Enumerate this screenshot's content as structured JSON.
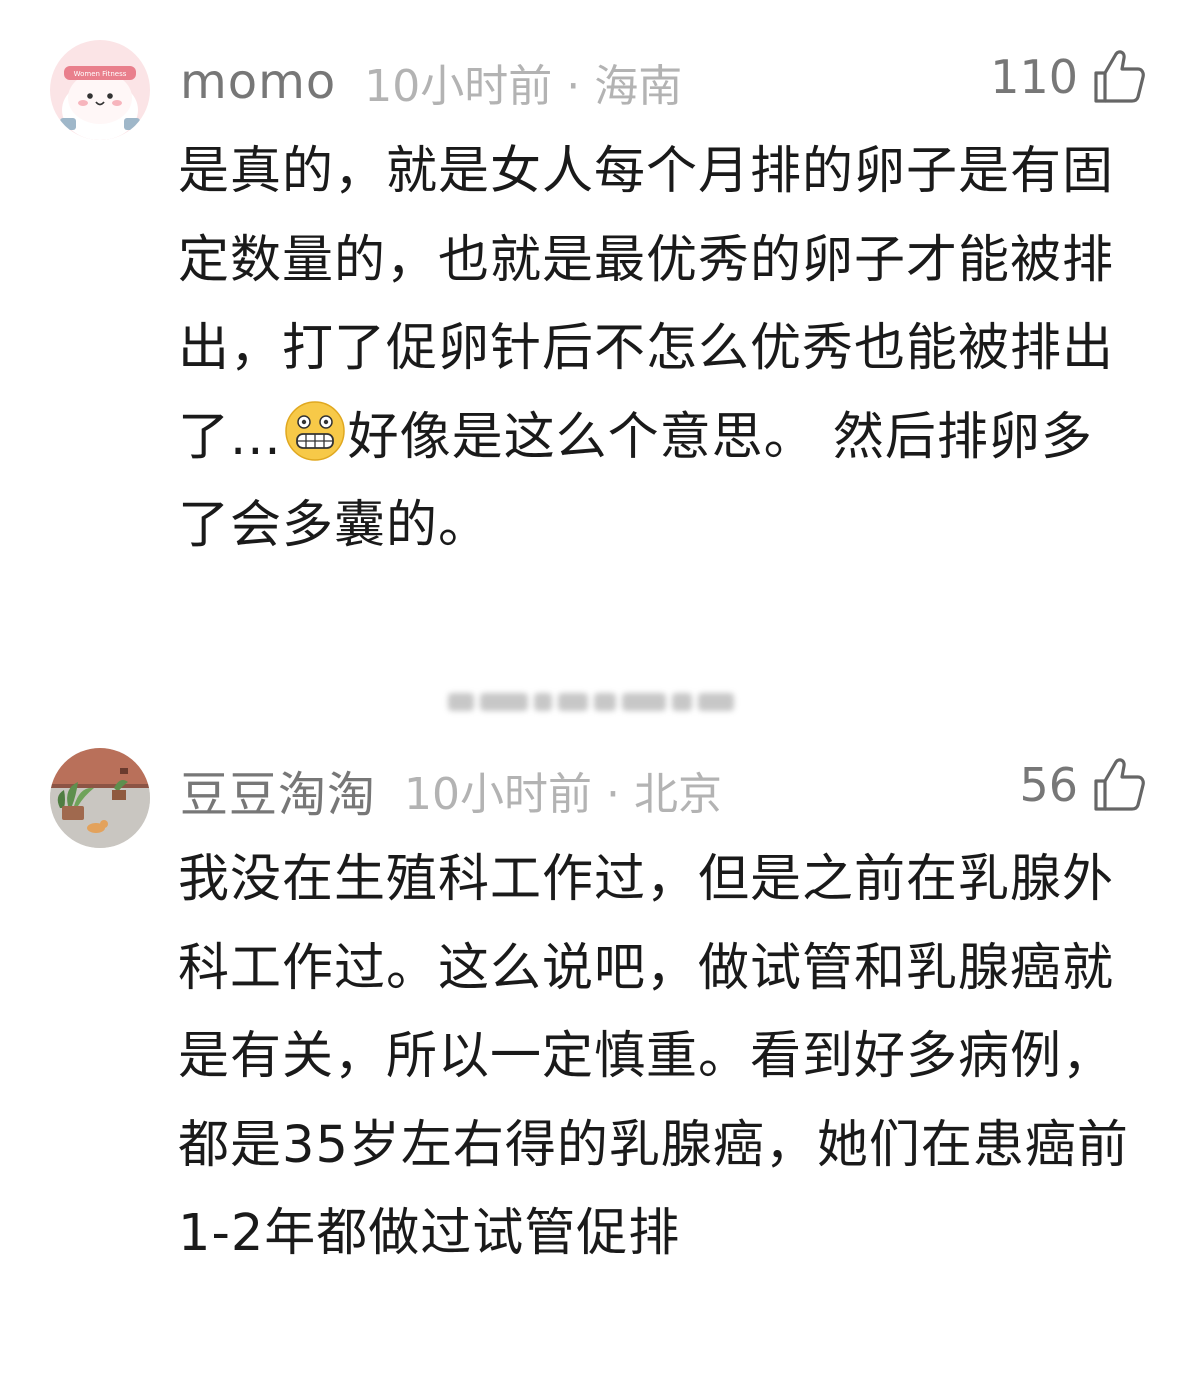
{
  "comments": [
    {
      "username": "momo",
      "time_location": "10小时前 · 海南",
      "likes": "110",
      "avatar_icon": "fitness-cartoon-avatar",
      "avatar_caption": "Women Fitness",
      "text_before_emoji": "是真的，就是女人每个月排的卵子是有固定数量的，也就是最优秀的卵子才能被排出，打了促卵针后不怎么优秀也能被排出了...",
      "emoji": "grimacing-face",
      "text_after_emoji": "好像是这么个意思。 然后排卵多了会多囊的。"
    },
    {
      "username": "豆豆淘淘",
      "time_location": "10小时前 · 北京",
      "likes": "56",
      "avatar_icon": "plants-and-cat-photo-avatar",
      "text": "我没在生殖科工作过，但是之前在乳腺外科工作过。这么说吧，做试管和乳腺癌就是有关，所以一定慎重。看到好多病例，都是35岁左右得的乳腺癌，她们在患癌前1-2年都做过试管促排"
    }
  ],
  "colors": {
    "username": "#777777",
    "meta": "#b3b3b3",
    "body_text": "#1a1a1a",
    "background": "#ffffff"
  }
}
